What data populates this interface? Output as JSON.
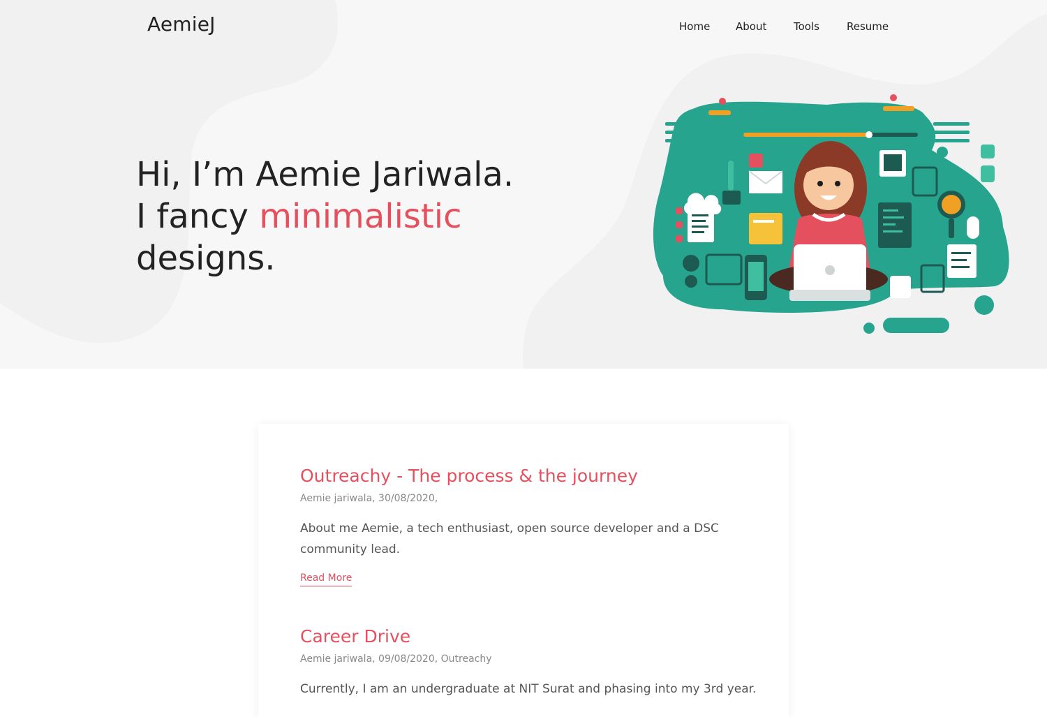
{
  "site": {
    "logo": "AemieJ"
  },
  "nav": {
    "items": [
      "Home",
      "About",
      "Tools",
      "Resume"
    ]
  },
  "hero": {
    "line1": "Hi, I’m Aemie Jariwala.",
    "line2_prefix": "I fancy ",
    "line2_accent": "minimalistic",
    "line3": "designs."
  },
  "posts": [
    {
      "title": "Outreachy - The process & the journey",
      "meta": "Aemie jariwala, 30/08/2020,",
      "excerpt": "About me Aemie, a tech enthusiast, open source developer and a DSC community lead.",
      "read_more": "Read More"
    },
    {
      "title": "Career Drive",
      "meta": "Aemie jariwala, 09/08/2020, Outreachy",
      "excerpt": "Currently, I am an undergraduate at NIT Surat and phasing into my 3rd year."
    }
  ],
  "colors": {
    "accent": "#e5505e",
    "teal": "#26a48e",
    "hero_bg": "#f7f7f7"
  },
  "icons": [
    "developer-illustration"
  ]
}
